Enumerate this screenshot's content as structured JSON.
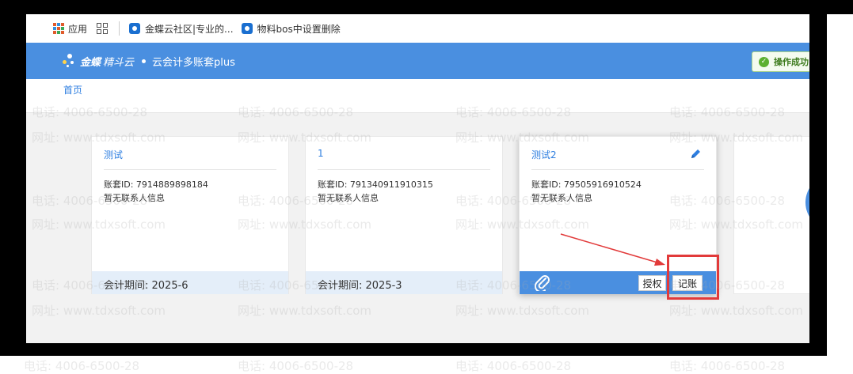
{
  "bookmarks": {
    "apps_label": "应用",
    "items": [
      {
        "label": "金蝶云社区|专业的..."
      },
      {
        "label": "物料bos中设置删除"
      }
    ]
  },
  "appbar": {
    "brand": "金蝶",
    "brand_sub": "精斗云",
    "title": "云会计多账套plus",
    "toast": "操作成功"
  },
  "breadcrumb": {
    "home": "首页"
  },
  "cards": [
    {
      "name": "测试",
      "account_id": "账套ID: 7914889898184",
      "contact": "暂无联系人信息",
      "period": "会计期间: 2025-6"
    },
    {
      "name": "1",
      "account_id": "账套ID: 791340911910315",
      "contact": "暂无联系人信息",
      "period": "会计期间: 2025-3"
    },
    {
      "name": "测试2",
      "account_id": "账套ID: 79505916910524",
      "contact": "暂无联系人信息",
      "auth_label": "授权",
      "bookkeeping_label": "记账"
    }
  ],
  "watermark": {
    "phone": "电话: 4006-6500-28",
    "site": "网址: www.tdxsoft.com"
  },
  "colors": {
    "primary": "#4a8fe0",
    "link": "#2d7ee0",
    "highlight": "#e23a3a"
  }
}
